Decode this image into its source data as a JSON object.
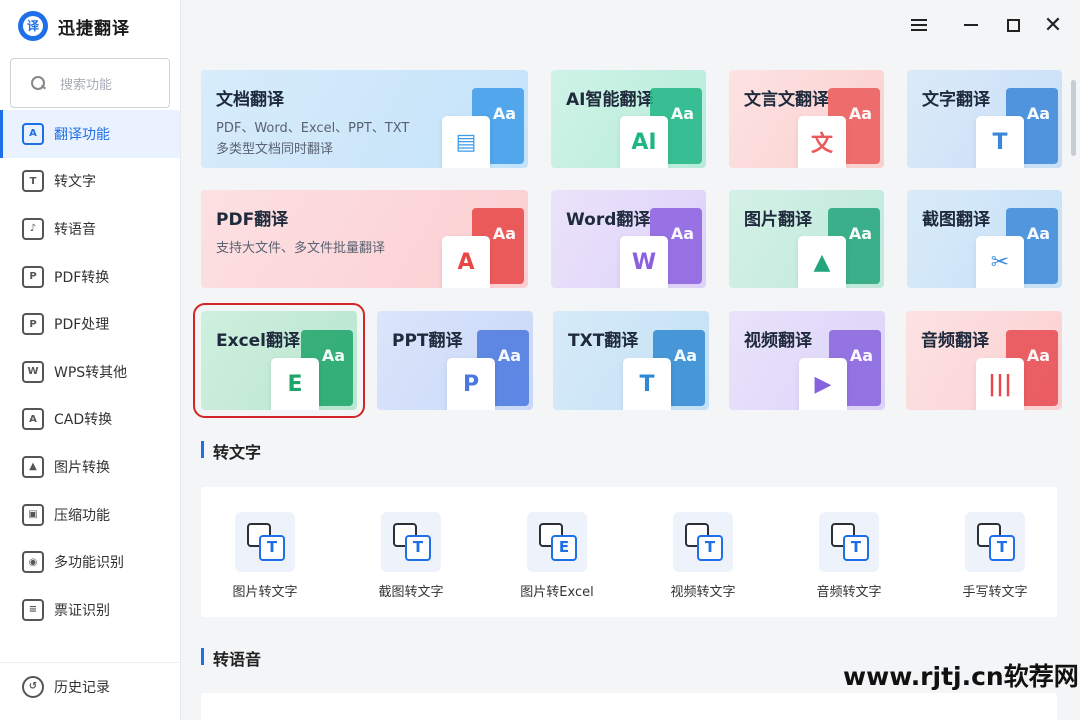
{
  "app": {
    "title": "迅捷翻译",
    "logo_char": "译"
  },
  "search": {
    "placeholder": "搜索功能"
  },
  "sidebar": {
    "items": [
      {
        "label": "翻译功能",
        "icon": "A",
        "name": "translate",
        "active": true
      },
      {
        "label": "转文字",
        "icon": "T",
        "name": "to-text"
      },
      {
        "label": "转语音",
        "icon": "♪",
        "name": "to-speech"
      },
      {
        "label": "PDF转换",
        "icon": "P",
        "name": "pdf-convert"
      },
      {
        "label": "PDF处理",
        "icon": "P",
        "name": "pdf-process"
      },
      {
        "label": "WPS转其他",
        "icon": "W",
        "name": "wps-convert"
      },
      {
        "label": "CAD转换",
        "icon": "A",
        "name": "cad-convert"
      },
      {
        "label": "图片转换",
        "icon": "▲",
        "name": "image-convert"
      },
      {
        "label": "压缩功能",
        "icon": "▣",
        "name": "compress"
      },
      {
        "label": "多功能识别",
        "icon": "◉",
        "name": "multi-recognize"
      },
      {
        "label": "票证识别",
        "icon": "≡",
        "name": "ticket-recognize"
      }
    ],
    "history_label": "历史记录"
  },
  "cards": [
    {
      "title": "文档翻译",
      "desc1": "PDF、Word、Excel、PPT、TXT",
      "desc2": "多类型文档同时翻译",
      "glyph": "▤",
      "bg": "#d8ecfb",
      "bg2": "#c4e3fa",
      "accent": "#3d9be9"
    },
    {
      "title": "AI智能翻译",
      "glyph": "AI",
      "bg": "#cff3e7",
      "bg2": "#b7ecd9",
      "accent": "#20b585"
    },
    {
      "title": "文言文翻译",
      "glyph": "文",
      "bg": "#fde2e2",
      "bg2": "#fbd0d0",
      "accent": "#ea5a5a"
    },
    {
      "title": "文字翻译",
      "glyph": "T",
      "bg": "#dbeaf9",
      "bg2": "#c8dff7",
      "accent": "#3a86d8"
    },
    {
      "title": "PDF翻译",
      "desc1": "支持大文件、多文件批量翻译",
      "glyph": "A",
      "bg": "#fde0e2",
      "bg2": "#fbcfd2",
      "accent": "#e84545"
    },
    {
      "title": "Word翻译",
      "glyph": "W",
      "bg": "#ebe3fb",
      "bg2": "#ddd1f8",
      "accent": "#8b5fe0"
    },
    {
      "title": "图片翻译",
      "glyph": "▲",
      "bg": "#d4f1e7",
      "bg2": "#bfe9da",
      "accent": "#22a57a"
    },
    {
      "title": "截图翻译",
      "glyph": "✂",
      "bg": "#d9ebf9",
      "bg2": "#c6e0f6",
      "accent": "#3c8ad8"
    },
    {
      "title": "Excel翻译",
      "glyph": "E",
      "bg": "#cfefdf",
      "bg2": "#b8e6cf",
      "accent": "#1da56a",
      "selected": true
    },
    {
      "title": "PPT翻译",
      "glyph": "P",
      "bg": "#dbe5fb",
      "bg2": "#c9d8f8",
      "accent": "#4a78e0"
    },
    {
      "title": "TXT翻译",
      "glyph": "T",
      "bg": "#d7ebf8",
      "bg2": "#c3e0f6",
      "accent": "#2f88d2"
    },
    {
      "title": "视频翻译",
      "glyph": "▶",
      "bg": "#e9e3fb",
      "bg2": "#dcd2f8",
      "accent": "#8662de"
    },
    {
      "title": "音频翻译",
      "glyph": "|||",
      "bg": "#fde2e3",
      "bg2": "#fbd0d2",
      "accent": "#e64a4f"
    }
  ],
  "sections": {
    "to_text": {
      "title": "转文字",
      "tools": [
        {
          "label": "图片转文字",
          "glyph": "T"
        },
        {
          "label": "截图转文字",
          "glyph": "T"
        },
        {
          "label": "图片转Excel",
          "glyph": "E"
        },
        {
          "label": "视频转文字",
          "glyph": "T"
        },
        {
          "label": "音频转文字",
          "glyph": "T"
        },
        {
          "label": "手写转文字",
          "glyph": "T"
        }
      ]
    },
    "to_speech": {
      "title": "转语音"
    }
  },
  "watermark": "www.rjtj.cn软荐网"
}
